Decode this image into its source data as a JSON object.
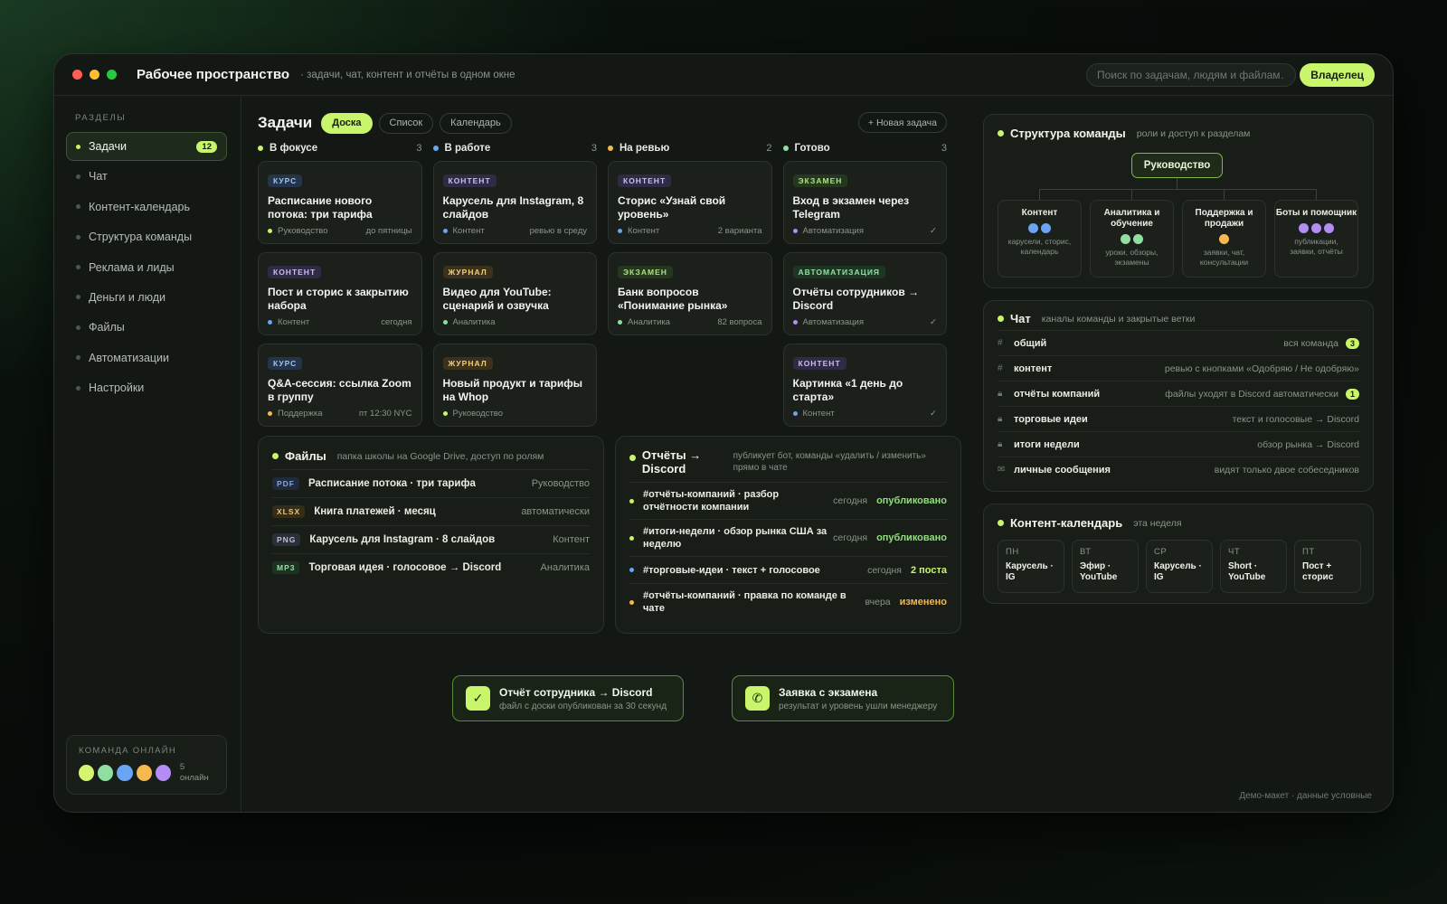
{
  "app": {
    "title": "Рабочее пространство",
    "subtitle": "· задачи, чат, контент и отчёты в одном окне",
    "search_placeholder": "Поиск по задачам, людям и файлам…",
    "owner_label": "Владелец"
  },
  "window_dots": [
    "#ff5f57",
    "#febc2e",
    "#28c840"
  ],
  "sidebar": {
    "section_label": "РАЗДЕЛЫ",
    "items": [
      {
        "label": "Задачи",
        "badge": "12",
        "active": true
      },
      {
        "label": "Чат"
      },
      {
        "label": "Контент-календарь"
      },
      {
        "label": "Структура команды"
      },
      {
        "label": "Реклама и лиды"
      },
      {
        "label": "Деньги и люди"
      },
      {
        "label": "Файлы"
      },
      {
        "label": "Автоматизации"
      },
      {
        "label": "Настройки"
      }
    ],
    "online": {
      "label": "КОМАНДА ОНЛАЙН",
      "avatars": [
        "#d6f56e",
        "#8fe0a0",
        "#6aa4f5",
        "#f5b94e",
        "#b58cf5"
      ],
      "count_text": "5 онлайн"
    }
  },
  "tasks": {
    "title": "Задачи",
    "views": [
      "Доска",
      "Список",
      "Календарь"
    ],
    "new_task": "+ Новая задача",
    "columns": [
      {
        "name": "В фокусе",
        "count": "3",
        "color": "#c8f56a",
        "cards": [
          {
            "tag": "КУРС",
            "tag_kind": "course",
            "title": "Расписание нового потока: три тарифа",
            "owner": "Руководство",
            "owner_color": "#c8f56a",
            "meta": "до пятницы"
          },
          {
            "tag": "КОНТЕНТ",
            "tag_kind": "content",
            "title": "Пост и сторис к закрытию набора",
            "owner": "Контент",
            "owner_color": "#6aa4f5",
            "meta": "сегодня"
          },
          {
            "tag": "КУРС",
            "tag_kind": "course",
            "title": "Q&A-сессия: ссылка Zoom в группу",
            "owner": "Поддержка",
            "owner_color": "#f5b94e",
            "meta": "пт 12:30 NYC"
          }
        ]
      },
      {
        "name": "В работе",
        "count": "3",
        "color": "#6aa4f5",
        "cards": [
          {
            "tag": "КОНТЕНТ",
            "tag_kind": "content",
            "title": "Карусель для Instagram, 8 слайдов",
            "owner": "Контент",
            "owner_color": "#6aa4f5",
            "meta": "ревью в среду"
          },
          {
            "tag": "ЖУРНАЛ",
            "tag_kind": "journal",
            "title": "Видео для YouTube: сценарий и озвучка",
            "owner": "Аналитика",
            "owner_color": "#8fe0a0",
            "meta": ""
          },
          {
            "tag": "ЖУРНАЛ",
            "tag_kind": "journal",
            "title": "Новый продукт и тарифы на Whop",
            "owner": "Руководство",
            "owner_color": "#c8f56a",
            "meta": ""
          }
        ]
      },
      {
        "name": "На ревью",
        "count": "2",
        "color": "#f5b94e",
        "cards": [
          {
            "tag": "КОНТЕНТ",
            "tag_kind": "content",
            "title": "Сторис «Узнай свой уровень»",
            "owner": "Контент",
            "owner_color": "#6aa4f5",
            "meta": "2 варианта"
          },
          {
            "tag": "ЭКЗАМЕН",
            "tag_kind": "exam",
            "title": "Банк вопросов «Понимание рынка»",
            "owner": "Аналитика",
            "owner_color": "#8fe0a0",
            "meta": "82 вопроса"
          }
        ]
      },
      {
        "name": "Готово",
        "count": "3",
        "color": "#8fe0a0",
        "cards": [
          {
            "tag": "ЭКЗАМЕН",
            "tag_kind": "exam",
            "title": "Вход в экзамен через Telegram",
            "owner": "Автоматизация",
            "owner_color": "#b58cf5",
            "meta": "✓"
          },
          {
            "tag": "АВТОМАТИЗАЦИЯ",
            "tag_kind": "auto",
            "title": "Отчёты сотрудников → Discord",
            "owner": "Автоматизация",
            "owner_color": "#b58cf5",
            "meta": "✓"
          },
          {
            "tag": "КОНТЕНТ",
            "tag_kind": "content",
            "title": "Картинка «1 день до старта»",
            "owner": "Контент",
            "owner_color": "#6aa4f5",
            "meta": "✓"
          }
        ]
      }
    ]
  },
  "files": {
    "title": "Файлы",
    "subtitle": "папка школы на Google Drive, доступ по ролям",
    "items": [
      {
        "type": "PDF",
        "type_color": "#7fa8e8",
        "type_bg": "#1f2b3c",
        "name": "Расписание потока · три тарифа",
        "meta": "Руководство"
      },
      {
        "type": "XLSX",
        "type_color": "#e6c873",
        "type_bg": "#352d17",
        "name": "Книга платежей · месяц",
        "meta": "автоматически"
      },
      {
        "type": "PNG",
        "type_color": "#b9c2d8",
        "type_bg": "#2a2f3a",
        "name": "Карусель для Instagram · 8 слайдов",
        "meta": "Контент"
      },
      {
        "type": "MP3",
        "type_color": "#8fe0a0",
        "type_bg": "#1d3222",
        "name": "Торговая идея · голосовое → Discord",
        "meta": "Аналитика"
      }
    ]
  },
  "reports": {
    "title": "Отчёты → Discord",
    "subtitle": "публикует бот, команды «удалить / изменить» прямо в чате",
    "items": [
      {
        "dot": "#c8f56a",
        "text": "#отчёты-компаний · разбор отчётности компании",
        "when": "сегодня",
        "status": "опубликовано",
        "status_color": "#8fe07a"
      },
      {
        "dot": "#c8f56a",
        "text": "#итоги-недели · обзор рынка США за неделю",
        "when": "сегодня",
        "status": "опубликовано",
        "status_color": "#8fe07a"
      },
      {
        "dot": "#6aa4f5",
        "text": "#торговые-идеи · текст + голосовое",
        "when": "сегодня",
        "status": "2 поста",
        "status_color": "#c8f56a"
      },
      {
        "dot": "#f5b94e",
        "text": "#отчёты-компаний · правка по команде в чате",
        "when": "вчера",
        "status": "изменено",
        "status_color": "#f5b94e"
      }
    ]
  },
  "structure": {
    "title": "Структура команды",
    "subtitle": "роли и доступ к разделам",
    "root": "Руководство",
    "groups": [
      {
        "name": "Контент",
        "dots": [
          "#6aa4f5",
          "#6aa4f5"
        ],
        "desc": "карусели, сторис, календарь"
      },
      {
        "name": "Аналитика и обучение",
        "dots": [
          "#8fe0a0",
          "#8fe0a0"
        ],
        "desc": "уроки, обзоры, экзамены"
      },
      {
        "name": "Поддержка и продажи",
        "dots": [
          "#f5b94e"
        ],
        "desc": "заявки, чат, консультации"
      },
      {
        "name": "Боты и помощник",
        "dots": [
          "#b58cf5",
          "#b58cf5",
          "#b58cf5"
        ],
        "desc": "публикации, заявки, отчёты"
      }
    ]
  },
  "chat": {
    "title": "Чат",
    "subtitle": "каналы команды и закрытые ветки",
    "channels": [
      {
        "icon": "#",
        "name": "общий",
        "desc": "вся команда",
        "badge": "3"
      },
      {
        "icon": "#",
        "name": "контент",
        "desc": "ревью с кнопками «Одобряю / Не одобряю»",
        "badge": ""
      },
      {
        "icon": "lock",
        "name": "отчёты компаний",
        "desc": "файлы уходят в Discord автоматически",
        "badge": "1"
      },
      {
        "icon": "lock",
        "name": "торговые идеи",
        "desc": "текст и голосовые → Discord",
        "badge": ""
      },
      {
        "icon": "lock",
        "name": "итоги недели",
        "desc": "обзор рынка → Discord",
        "badge": ""
      },
      {
        "icon": "envelope",
        "name": "личные сообщения",
        "desc": "видят только двое собеседников",
        "badge": ""
      }
    ]
  },
  "calendar": {
    "title": "Контент-календарь",
    "subtitle": "эта неделя",
    "days": [
      {
        "day": "ПН",
        "event": "Карусель · IG"
      },
      {
        "day": "ВТ",
        "event": "Эфир · YouTube"
      },
      {
        "day": "СР",
        "event": "Карусель · IG"
      },
      {
        "day": "ЧТ",
        "event": "Short · YouTube"
      },
      {
        "day": "ПТ",
        "event": "Пост + сторис"
      }
    ]
  },
  "toasts": [
    {
      "icon": "check-icon",
      "glyph": "✓",
      "title": "Отчёт сотрудника → Discord",
      "subtitle": "файл с доски опубликован за 30 секунд"
    },
    {
      "icon": "phone-icon",
      "glyph": "✆",
      "title": "Заявка с экзамена",
      "subtitle": "результат и уровень ушли менеджеру"
    }
  ],
  "footer_note": "Демо-макет · данные условные",
  "colors": {
    "accent": "#c8f56a",
    "background": "#141814"
  }
}
